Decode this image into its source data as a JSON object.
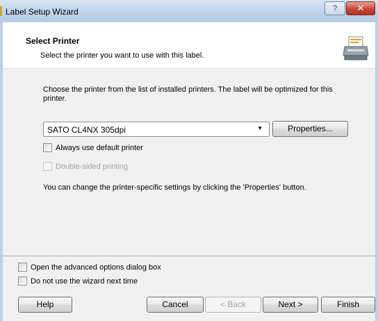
{
  "window": {
    "title": "Label Setup Wizard",
    "help_glyph": "?",
    "close_glyph": "✕"
  },
  "header": {
    "title": "Select Printer",
    "subtitle": "Select the printer you want to use with this label."
  },
  "body": {
    "description": "Choose the printer from the list of installed printers. The label will be optimized for this printer.",
    "printer_select": {
      "value": "SATO CL4NX 305dpi",
      "arrow": "▼"
    },
    "properties_button": "Properties...",
    "always_default": {
      "label": "Always use default printer",
      "checked": false
    },
    "double_sided": {
      "label": "Double-sided printing",
      "checked": false,
      "enabled": false
    },
    "note": "You can change the printer-specific settings by clicking the 'Properties' button."
  },
  "footer": {
    "advanced_options": {
      "label": "Open the advanced options dialog box",
      "checked": false
    },
    "no_wizard": {
      "label": "Do not use the wizard next time",
      "checked": false
    },
    "buttons": {
      "help": "Help",
      "cancel": "Cancel",
      "back": "< Back",
      "next": "Next >",
      "finish": "Finish"
    }
  },
  "icons": {
    "header": "printer-icon"
  }
}
